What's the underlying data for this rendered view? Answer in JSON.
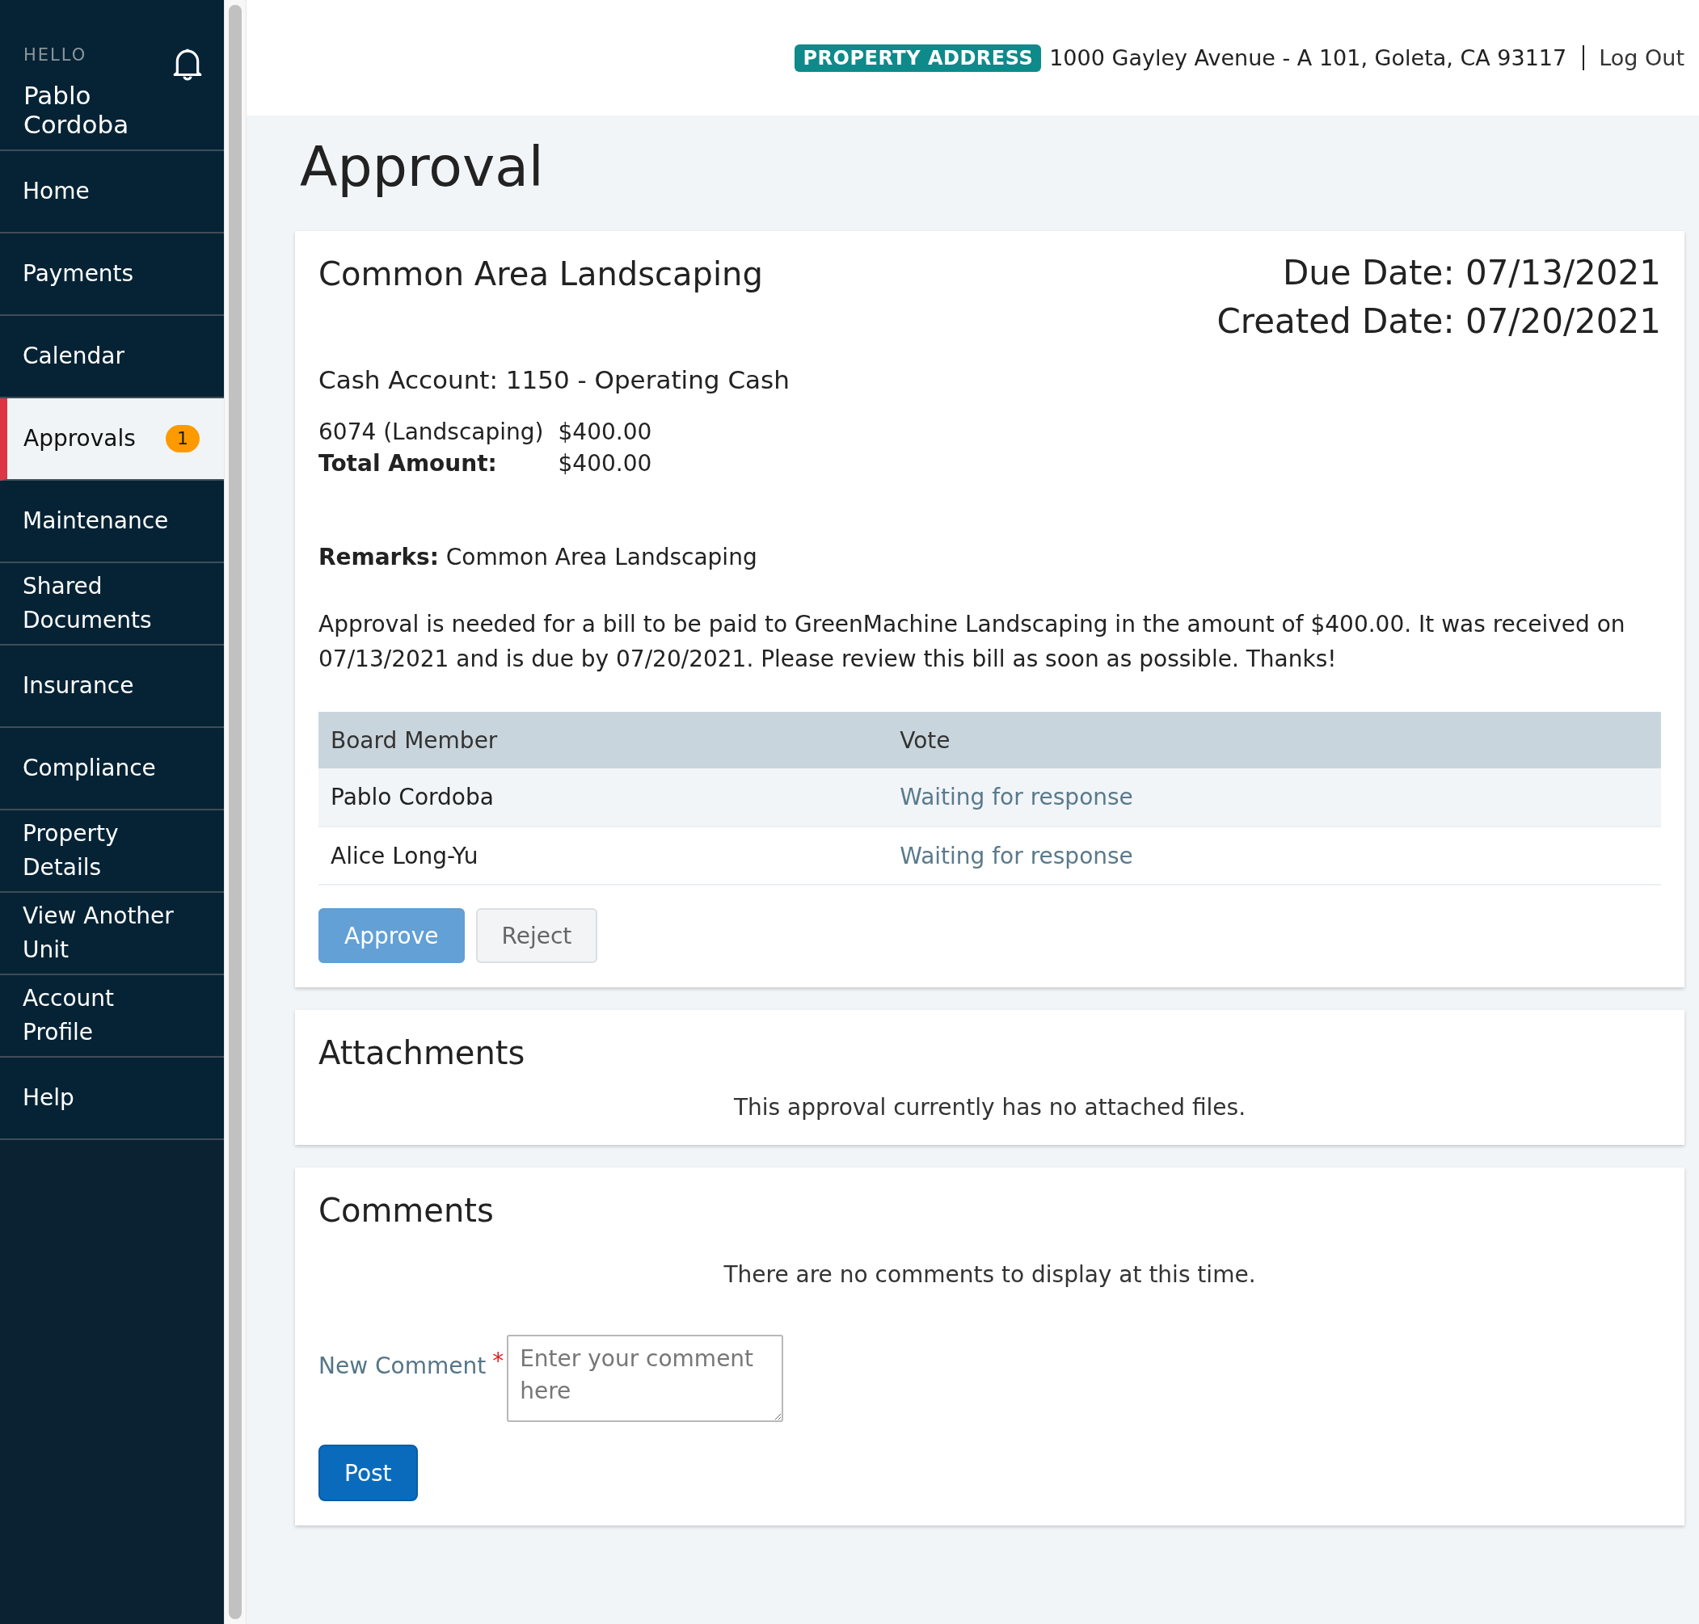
{
  "sidebar": {
    "greeting": "HELLO",
    "user_name": "Pablo Cordoba",
    "items": [
      {
        "label": "Home",
        "selected": false
      },
      {
        "label": "Payments",
        "selected": false
      },
      {
        "label": "Calendar",
        "selected": false
      },
      {
        "label": "Approvals",
        "selected": true,
        "badge": "1"
      },
      {
        "label": "Maintenance",
        "selected": false
      },
      {
        "label": "Shared Documents",
        "selected": false
      },
      {
        "label": "Insurance",
        "selected": false
      },
      {
        "label": "Compliance",
        "selected": false
      },
      {
        "label": "Property Details",
        "selected": false
      },
      {
        "label": "View Another Unit",
        "selected": false
      },
      {
        "label": "Account Profile",
        "selected": false
      },
      {
        "label": "Help",
        "selected": false
      }
    ]
  },
  "header": {
    "address_label": "PROPERTY ADDRESS",
    "address": "1000 Gayley Avenue - A 101, Goleta, CA 93117",
    "logout": "Log Out"
  },
  "page_title": "Approval",
  "approval": {
    "title": "Common Area Landscaping",
    "due_date": "Due Date: 07/13/2021",
    "created_date": "Created Date: 07/20/2021",
    "cash_account": "Cash Account: 1150 - Operating Cash",
    "line_items": [
      {
        "label": "6074 (Landscaping)",
        "amount": "$400.00",
        "kind": "item"
      },
      {
        "label": "Total Amount:",
        "amount": "$400.00",
        "kind": "total"
      }
    ],
    "remarks": "**Remarks:** Common Area Landscaping",
    "description": "Approval is needed for a bill to be paid to GreenMachine Landscaping in the amount of $400.00. It was received on 07/13/2021 and is due by 07/20/2021. Please review this bill as soon as possible. Thanks!",
    "table": {
      "columns": [
        "Board Member",
        "Vote"
      ],
      "rows": [
        [
          "Pablo Cordoba",
          "Waiting for response"
        ],
        [
          "Alice Long-Yu",
          "Waiting for response"
        ]
      ]
    },
    "buttons": [
      {
        "label": "Approve",
        "kind": "primary"
      },
      {
        "label": "Reject",
        "kind": "secondary"
      }
    ]
  },
  "attachments": {
    "title": "Attachments",
    "empty_message": "This approval currently has no attached files."
  },
  "comments": {
    "title": "Comments",
    "empty_message": "There are no comments to display at this time.",
    "field_label": "New Comment",
    "required_mark": "*",
    "placeholder": "Enter your comment here",
    "submit": "Post"
  }
}
